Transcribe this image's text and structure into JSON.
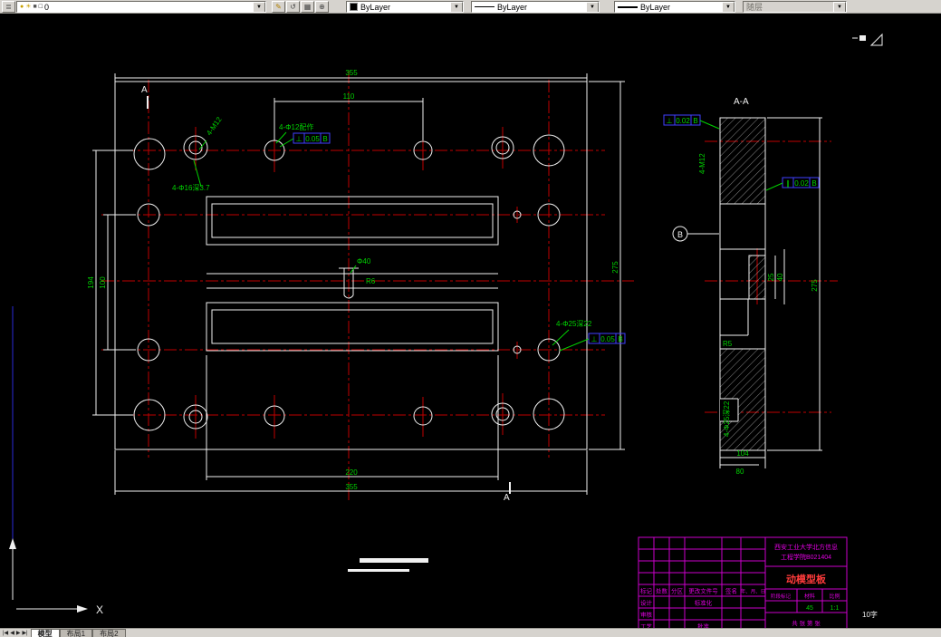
{
  "toolbar": {
    "layer_value": "0",
    "color_value": "ByLayer",
    "linetype_value": "ByLayer",
    "lineweight_value": "ByLayer",
    "plotstyle_value": "随层"
  },
  "tabs": [
    {
      "label": "模型"
    },
    {
      "label": "布局1"
    },
    {
      "label": "布局2"
    }
  ],
  "drawing": {
    "section_label": "A-A",
    "cut_label_top": "A",
    "cut_label_bottom": "A",
    "datum_label": "B",
    "ucs_x_label": "X",
    "dims": {
      "top_overall": "355",
      "top_inner": "110",
      "left_outer": "194",
      "left_inner": "100",
      "right_outer": "275",
      "bottom_inner": "220",
      "bottom_outer": "355",
      "sec_height": "275",
      "sec_bottom1": "104",
      "sec_bottom2": "80",
      "sec_d1": "25",
      "sec_d2": "40",
      "sec_r": "R5"
    },
    "annotations": {
      "m12": "4-M12",
      "phi12": "4-Φ12配作",
      "phi16": "4-Φ16深3.7",
      "phi40": "Φ40",
      "r6": "R6",
      "phi25": "4-Φ25深22",
      "sec_m12": "4-M12",
      "sec_phi25": "4-Φ25深22"
    },
    "tolerances": {
      "t1_sym": "⊥",
      "t1_val": "0.05",
      "t1_ref": "B",
      "t2_sym": "⊥",
      "t2_val": "0.05",
      "t2_ref": "B",
      "t3_sym": "⊥",
      "t3_val": "0.02",
      "t3_ref": "B",
      "t4_sym": "∥",
      "t4_val": "0.02",
      "t4_ref": "B"
    }
  },
  "title_block": {
    "school_line1": "西安工业大学北方信息",
    "school_line2": "工程学院B021404",
    "part_name": "动模型板",
    "hdr_mark": "标记",
    "hdr_count": "处数",
    "hdr_zone": "分区",
    "hdr_doc": "更改文件号",
    "hdr_sign": "签名",
    "hdr_date": "年、月、日",
    "design": "设计",
    "standard": "标准化",
    "review": "审核",
    "process": "工艺",
    "approve": "批准",
    "stage": "阶段标记",
    "material": "材料",
    "scale": "比例",
    "material_value": "45",
    "scale_value": "1:1",
    "sheets": "共 张 第 张",
    "font_note": "10字"
  }
}
